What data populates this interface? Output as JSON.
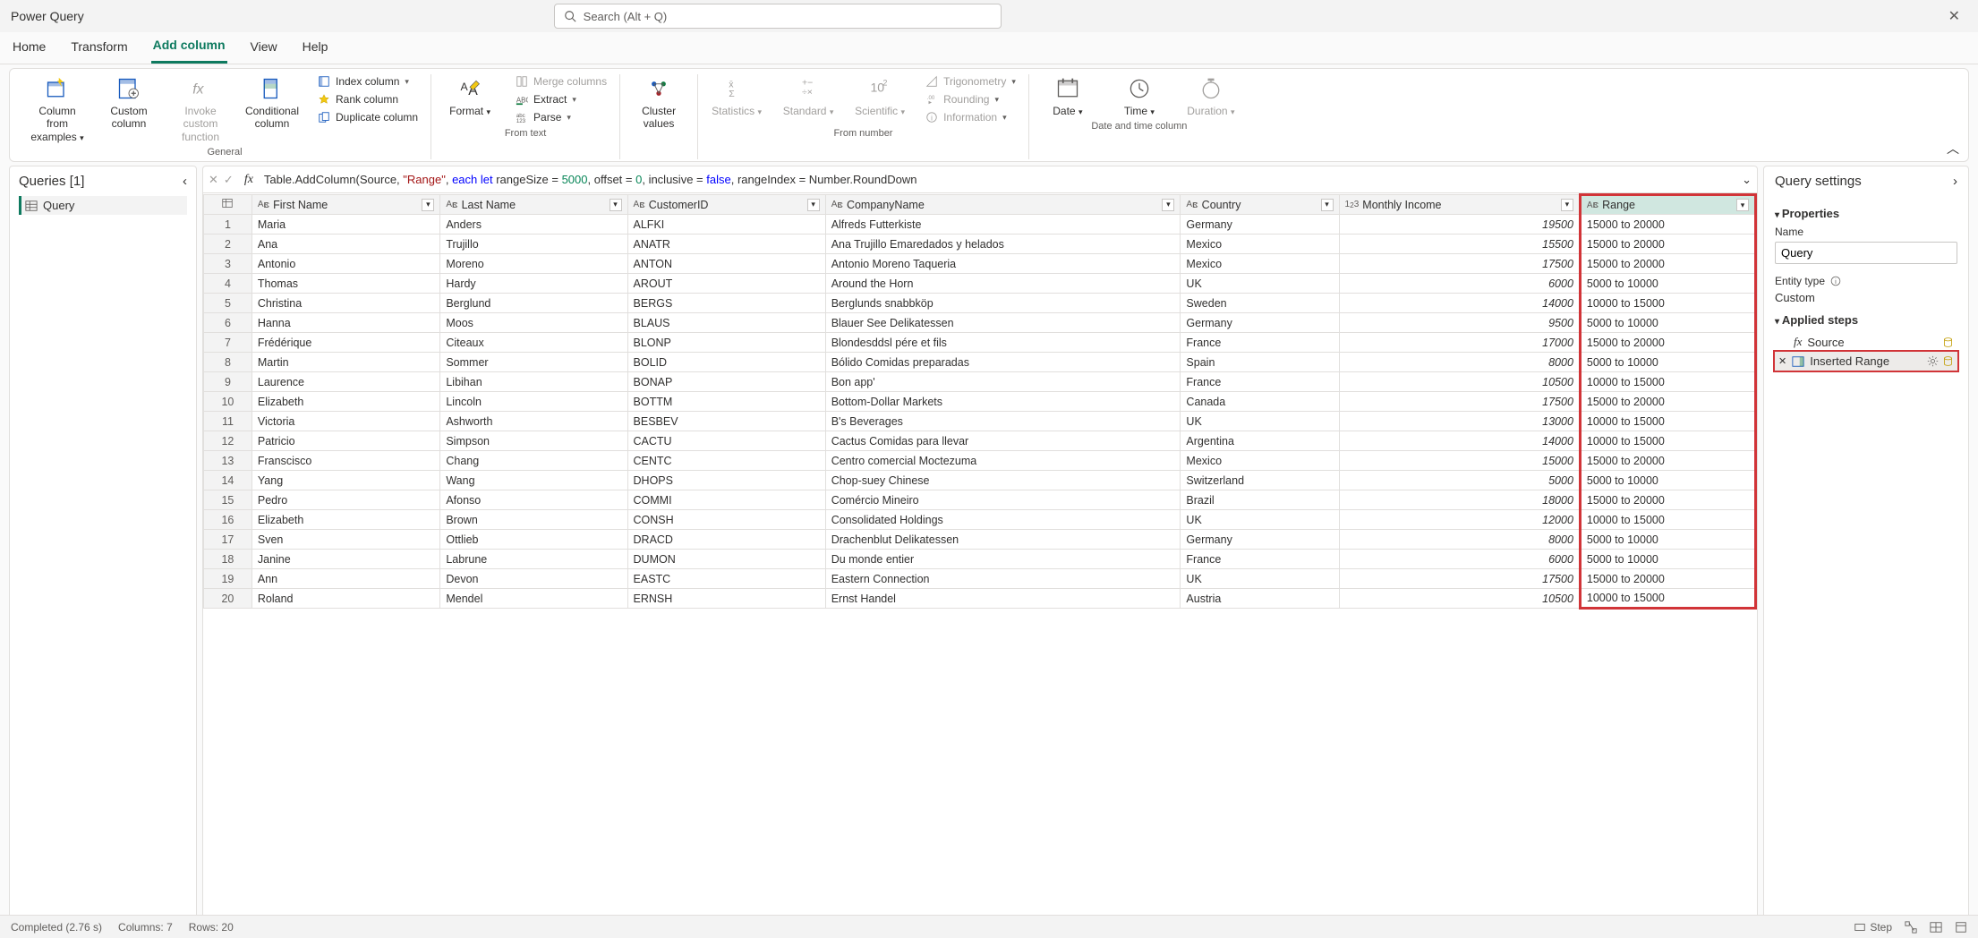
{
  "app": {
    "title": "Power Query",
    "search_placeholder": "Search (Alt + Q)"
  },
  "tabs": [
    "Home",
    "Transform",
    "Add column",
    "View",
    "Help"
  ],
  "active_tab": 2,
  "ribbon": {
    "groups": [
      {
        "label": "General",
        "big": [
          {
            "label": "Column from examples",
            "sub": "",
            "caret": true
          },
          {
            "label": "Custom column"
          },
          {
            "label": "Invoke custom function",
            "disabled": true
          },
          {
            "label": "Conditional column"
          }
        ],
        "small": [
          "Index column",
          "Rank column",
          "Duplicate column"
        ]
      },
      {
        "label": "From text",
        "big": [
          {
            "label": "Format",
            "caret": true
          }
        ],
        "small": [
          "Merge columns",
          "Extract",
          "Parse"
        ],
        "small_disabled": [
          0
        ]
      },
      {
        "label": "",
        "big": [
          {
            "label": "Cluster values"
          }
        ]
      },
      {
        "label": "From number",
        "big": [
          {
            "label": "Statistics",
            "disabled": true,
            "caret": true
          },
          {
            "label": "Standard",
            "disabled": true,
            "caret": true
          },
          {
            "label": "Scientific",
            "disabled": true,
            "caret": true
          }
        ],
        "small": [
          "Trigonometry",
          "Rounding",
          "Information"
        ],
        "small_disabled": [
          0,
          1,
          2
        ]
      },
      {
        "label": "Date and time column",
        "big": [
          {
            "label": "Date",
            "caret": true
          },
          {
            "label": "Time",
            "caret": true
          },
          {
            "label": "Duration",
            "disabled": true,
            "caret": true
          }
        ]
      }
    ]
  },
  "queries": {
    "header": "Queries [1]",
    "items": [
      "Query"
    ]
  },
  "formula": {
    "prefix": "Table.AddColumn(Source, ",
    "str": "\"Range\"",
    "mid1": ", ",
    "kw1": "each let",
    "mid2": " rangeSize = ",
    "n1": "5000",
    "mid3": ", offset = ",
    "n2": "0",
    "mid4": ", inclusive = ",
    "kw2": "false",
    "mid5": ", rangeIndex = Number.RoundDown"
  },
  "columns": [
    "First Name",
    "Last Name",
    "CustomerID",
    "CompanyName",
    "Country",
    "Monthly Income",
    "Range"
  ],
  "rows": [
    [
      "Maria",
      "Anders",
      "ALFKI",
      "Alfreds Futterkiste",
      "Germany",
      "19500",
      "15000 to 20000"
    ],
    [
      "Ana",
      "Trujillo",
      "ANATR",
      "Ana Trujillo Emaredados y helados",
      "Mexico",
      "15500",
      "15000 to 20000"
    ],
    [
      "Antonio",
      "Moreno",
      "ANTON",
      "Antonio Moreno Taqueria",
      "Mexico",
      "17500",
      "15000 to 20000"
    ],
    [
      "Thomas",
      "Hardy",
      "AROUT",
      "Around the Horn",
      "UK",
      "6000",
      "5000 to 10000"
    ],
    [
      "Christina",
      "Berglund",
      "BERGS",
      "Berglunds snabbköp",
      "Sweden",
      "14000",
      "10000 to 15000"
    ],
    [
      "Hanna",
      "Moos",
      "BLAUS",
      "Blauer See Delikatessen",
      "Germany",
      "9500",
      "5000 to 10000"
    ],
    [
      "Frédérique",
      "Citeaux",
      "BLONP",
      "Blondesddsl pére et fils",
      "France",
      "17000",
      "15000 to 20000"
    ],
    [
      "Martin",
      "Sommer",
      "BOLID",
      "Bólido Comidas preparadas",
      "Spain",
      "8000",
      "5000 to 10000"
    ],
    [
      "Laurence",
      "Libihan",
      "BONAP",
      "Bon app'",
      "France",
      "10500",
      "10000 to 15000"
    ],
    [
      "Elizabeth",
      "Lincoln",
      "BOTTM",
      "Bottom-Dollar Markets",
      "Canada",
      "17500",
      "15000 to 20000"
    ],
    [
      "Victoria",
      "Ashworth",
      "BESBEV",
      "B's Beverages",
      "UK",
      "13000",
      "10000 to 15000"
    ],
    [
      "Patricio",
      "Simpson",
      "CACTU",
      "Cactus Comidas para llevar",
      "Argentina",
      "14000",
      "10000 to 15000"
    ],
    [
      "Franscisco",
      "Chang",
      "CENTC",
      "Centro comercial Moctezuma",
      "Mexico",
      "15000",
      "15000 to 20000"
    ],
    [
      "Yang",
      "Wang",
      "DHOPS",
      "Chop-suey Chinese",
      "Switzerland",
      "5000",
      "5000 to 10000"
    ],
    [
      "Pedro",
      "Afonso",
      "COMMI",
      "Comércio Mineiro",
      "Brazil",
      "18000",
      "15000 to 20000"
    ],
    [
      "Elizabeth",
      "Brown",
      "CONSH",
      "Consolidated Holdings",
      "UK",
      "12000",
      "10000 to 15000"
    ],
    [
      "Sven",
      "Ottlieb",
      "DRACD",
      "Drachenblut Delikatessen",
      "Germany",
      "8000",
      "5000 to 10000"
    ],
    [
      "Janine",
      "Labrune",
      "DUMON",
      "Du monde entier",
      "France",
      "6000",
      "5000 to 10000"
    ],
    [
      "Ann",
      "Devon",
      "EASTC",
      "Eastern Connection",
      "UK",
      "17500",
      "15000 to 20000"
    ],
    [
      "Roland",
      "Mendel",
      "ERNSH",
      "Ernst Handel",
      "Austria",
      "10500",
      "10000 to 15000"
    ]
  ],
  "settings": {
    "header": "Query settings",
    "properties": "Properties",
    "name_label": "Name",
    "name_value": "Query",
    "entity_label": "Entity type",
    "entity_value": "Custom",
    "applied_label": "Applied steps",
    "steps": [
      {
        "label": "Source",
        "icon": "fx"
      },
      {
        "label": "Inserted Range",
        "icon": "table",
        "selected": true
      }
    ]
  },
  "status": {
    "left": "Completed (2.76 s)",
    "cols": "Columns: 7",
    "rows": "Rows: 20",
    "step": "Step"
  }
}
